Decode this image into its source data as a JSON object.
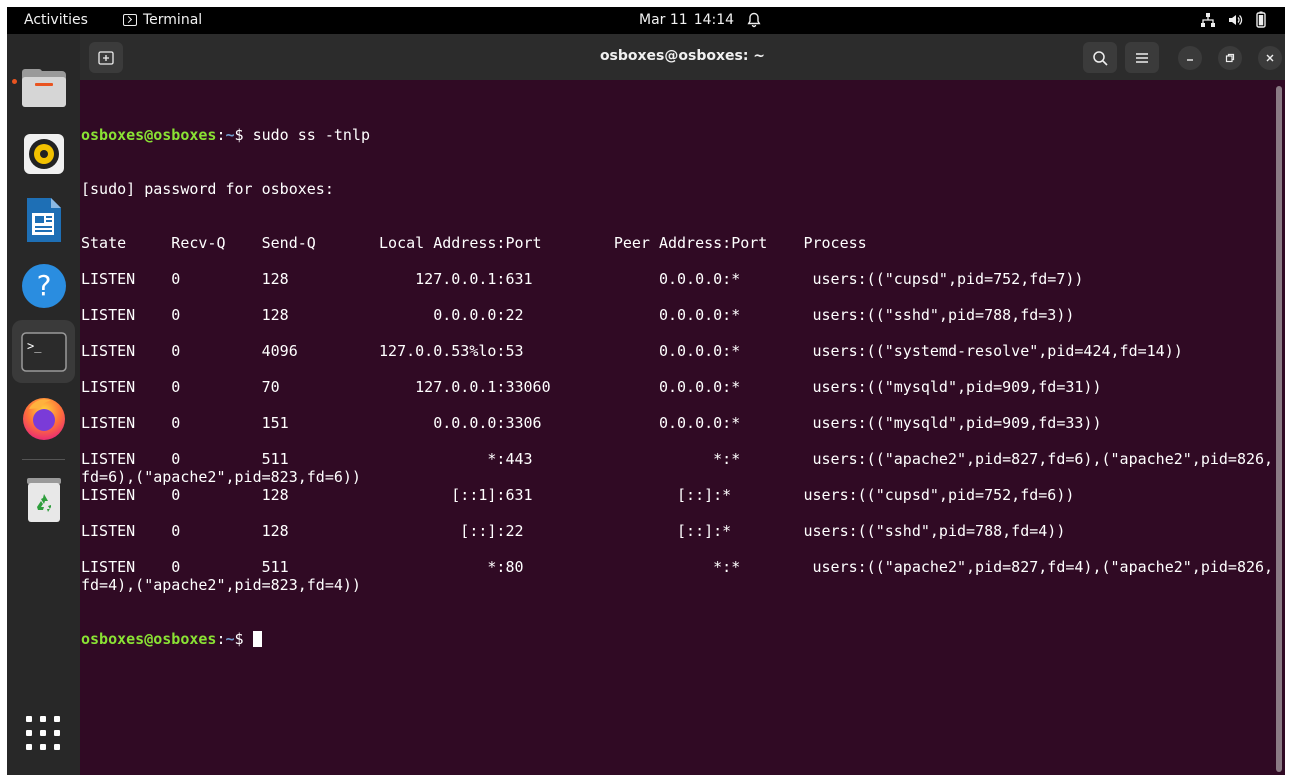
{
  "topbar": {
    "activities": "Activities",
    "app_name": "Terminal",
    "date": "Mar 11",
    "time": "14:14"
  },
  "dock": {
    "items": [
      {
        "name": "files",
        "icon": "folder-icon"
      },
      {
        "name": "rhythmbox",
        "icon": "speaker-icon"
      },
      {
        "name": "writer",
        "icon": "document-icon"
      },
      {
        "name": "help",
        "icon": "help-icon"
      },
      {
        "name": "terminal",
        "icon": "terminal-icon"
      },
      {
        "name": "firefox",
        "icon": "firefox-icon"
      },
      {
        "name": "trash",
        "icon": "trash-icon"
      }
    ]
  },
  "window": {
    "title": "osboxes@osboxes: ~"
  },
  "terminal": {
    "prompt_user": "osboxes@osboxes",
    "prompt_sep": ":",
    "prompt_path": "~",
    "prompt_sym": "$ ",
    "command": "sudo ss -tnlp",
    "sudo_line": "[sudo] password for osboxes:",
    "lines": [
      "State     Recv-Q    Send-Q       Local Address:Port        Peer Address:Port    Process",
      "",
      "LISTEN    0         128              127.0.0.1:631              0.0.0.0:*        users:((\"cupsd\",pid=752,fd=7))",
      "",
      "LISTEN    0         128                0.0.0.0:22               0.0.0.0:*        users:((\"sshd\",pid=788,fd=3))",
      "",
      "LISTEN    0         4096         127.0.0.53%lo:53               0.0.0.0:*        users:((\"systemd-resolve\",pid=424,fd=14))",
      "",
      "LISTEN    0         70               127.0.0.1:33060            0.0.0.0:*        users:((\"mysqld\",pid=909,fd=31))",
      "",
      "LISTEN    0         151                0.0.0.0:3306             0.0.0.0:*        users:((\"mysqld\",pid=909,fd=33))",
      "",
      "LISTEN    0         511                      *:443                    *:*        users:((\"apache2\",pid=827,fd=6),(\"apache2\",pid=826,",
      "fd=6),(\"apache2\",pid=823,fd=6))",
      "LISTEN    0         128                  [::1]:631                [::]:*        users:((\"cupsd\",pid=752,fd=6))",
      "",
      "LISTEN    0         128                   [::]:22                 [::]:*        users:((\"sshd\",pid=788,fd=4))",
      "",
      "LISTEN    0         511                      *:80                     *:*        users:((\"apache2\",pid=827,fd=4),(\"apache2\",pid=826,",
      "fd=4),(\"apache2\",pid=823,fd=4))"
    ]
  }
}
